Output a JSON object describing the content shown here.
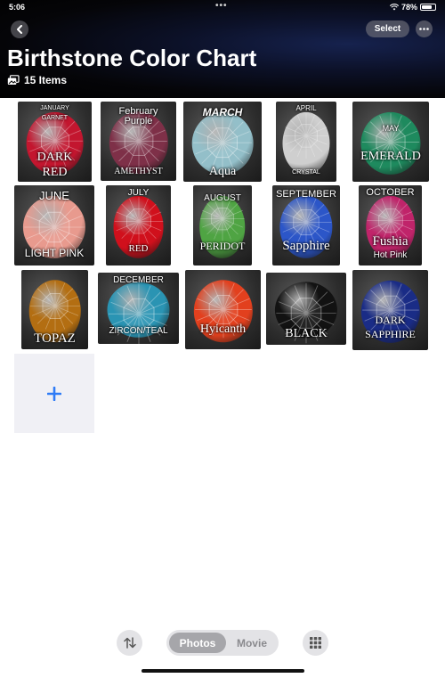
{
  "status_bar": {
    "time": "5:06",
    "dots": "•••",
    "battery": "78%",
    "battery_level": 0.78
  },
  "header": {
    "select_label": "Select",
    "title": "Birthstone Color Chart",
    "item_count": "15 Items"
  },
  "icons": {
    "back": "chevron-left-icon",
    "more": "ellipsis-icon",
    "stack": "photo-stack-icon",
    "add": "plus-icon",
    "sort": "sort-arrows-icon",
    "grid": "grid-icon",
    "wifi": "wifi-icon",
    "battery": "battery-icon"
  },
  "colors": {
    "accent": "#2f7cf6",
    "header_bg": "#000000"
  },
  "gems": [
    {
      "name": "january",
      "color": "#c3162f",
      "labels": [
        "JANUARY",
        "GARNET",
        "DARK",
        "RED"
      ]
    },
    {
      "name": "february",
      "color": "#7e3048",
      "labels": [
        "February",
        "Purple",
        "AMETHYST"
      ]
    },
    {
      "name": "march",
      "color": "#93bfc9",
      "labels": [
        "MARCH",
        "Aqua"
      ]
    },
    {
      "name": "april",
      "color": "#cfcfcf",
      "labels": [
        "APRIL",
        "CRYSTAL"
      ]
    },
    {
      "name": "may",
      "color": "#1e8a5e",
      "labels": [
        "MAY",
        "EMERALD"
      ]
    },
    {
      "name": "june",
      "color": "#e89a8e",
      "labels": [
        "JUNE",
        "LIGHT PINK"
      ]
    },
    {
      "name": "july",
      "color": "#d0101c",
      "labels": [
        "JULY",
        "RED"
      ]
    },
    {
      "name": "august",
      "color": "#4fa443",
      "labels": [
        "AUGUST",
        "PERIDOT"
      ]
    },
    {
      "name": "september",
      "color": "#2c56c8",
      "labels": [
        "SEPTEMBER",
        "Sapphire"
      ]
    },
    {
      "name": "october",
      "color": "#c0246a",
      "labels": [
        "OCTOBER",
        "Fushia",
        "Hot Pink"
      ]
    },
    {
      "name": "topaz",
      "color": "#b36e12",
      "labels": [
        "TOPAZ"
      ]
    },
    {
      "name": "december",
      "color": "#2a94b3",
      "labels": [
        "DECEMBER",
        "ZIRCON/TEAL"
      ]
    },
    {
      "name": "hyicanth",
      "color": "#e2401e",
      "labels": [
        "Hyicanth"
      ]
    },
    {
      "name": "black",
      "color": "#121212",
      "labels": [
        "BLACK"
      ]
    },
    {
      "name": "dark-sapphire",
      "color": "#1a2c86",
      "labels": [
        "DARK",
        "SAPPHIRE"
      ]
    }
  ],
  "toolbar": {
    "photos_label": "Photos",
    "movie_label": "Movie"
  }
}
